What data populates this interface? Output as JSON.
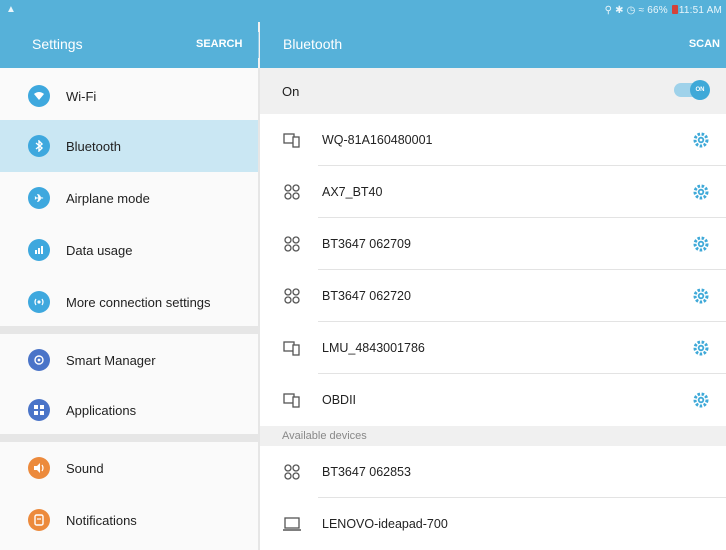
{
  "status_bar": {
    "icons": [
      "location-icon",
      "bluetooth-icon",
      "alarm-icon",
      "wifi-icon",
      "battery-icon"
    ],
    "battery_percent": "66%",
    "time": "11:51 AM"
  },
  "settings_bar": {
    "title": "Settings",
    "search_label": "SEARCH"
  },
  "bluetooth_bar": {
    "title": "Bluetooth",
    "scan_label": "SCAN"
  },
  "sidebar": {
    "items": [
      {
        "label": "Wi-Fi",
        "icon": "wifi-icon",
        "color": "#3ea8de"
      },
      {
        "label": "Bluetooth",
        "icon": "bluetooth-icon",
        "color": "#3ea8de",
        "active": true
      },
      {
        "label": "Airplane mode",
        "icon": "airplane-icon",
        "color": "#3ea8de"
      },
      {
        "label": "Data usage",
        "icon": "data-usage-icon",
        "color": "#3ea8de"
      },
      {
        "label": "More connection settings",
        "icon": "connection-icon",
        "color": "#3ea8de"
      },
      {
        "label": "Smart Manager",
        "icon": "smart-manager-icon",
        "color": "#4a74c8"
      },
      {
        "label": "Applications",
        "icon": "applications-icon",
        "color": "#4a74c8"
      },
      {
        "label": "Sound",
        "icon": "sound-icon",
        "color": "#ec8a3c"
      },
      {
        "label": "Notifications",
        "icon": "notifications-icon",
        "color": "#ec8a3c"
      }
    ]
  },
  "bluetooth": {
    "toggle_label": "On",
    "toggle_state": "ON",
    "paired_devices": [
      {
        "name": "WQ-81A160480001",
        "icon": "phone-icon"
      },
      {
        "name": "AX7_BT40",
        "icon": "generic-device-icon"
      },
      {
        "name": "BT3647 062709",
        "icon": "generic-device-icon"
      },
      {
        "name": "BT3647 062720",
        "icon": "generic-device-icon"
      },
      {
        "name": "LMU_4843001786",
        "icon": "phone-icon"
      },
      {
        "name": "OBDII",
        "icon": "phone-icon"
      }
    ],
    "available_header": "Available devices",
    "available_devices": [
      {
        "name": "BT3647 062853",
        "icon": "generic-device-icon"
      },
      {
        "name": "LENOVO-ideapad-700",
        "icon": "laptop-icon"
      }
    ]
  },
  "colors": {
    "primary": "#56b1d9",
    "accent": "#3fa9d8",
    "selected_bg": "#cae7f3"
  }
}
